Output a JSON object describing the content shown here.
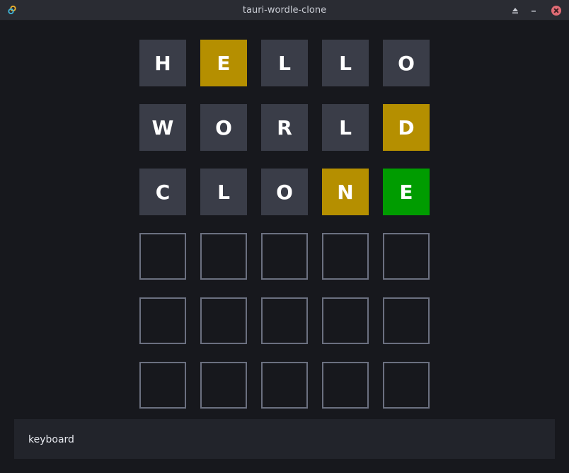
{
  "window": {
    "title": "tauri-wordle-clone"
  },
  "icons": {
    "app": "tauri-app-icon",
    "keep_above": "eject-icon",
    "minimize": "minimize-icon",
    "close": "close-icon"
  },
  "colors": {
    "absent": "#3a3d48",
    "present": "#b58f00",
    "correct": "#009c00",
    "empty_border": "#6b7080",
    "close": "#e06c75"
  },
  "board": {
    "rows": [
      [
        {
          "letter": "H",
          "state": "absent"
        },
        {
          "letter": "E",
          "state": "present"
        },
        {
          "letter": "L",
          "state": "absent"
        },
        {
          "letter": "L",
          "state": "absent"
        },
        {
          "letter": "O",
          "state": "absent"
        }
      ],
      [
        {
          "letter": "W",
          "state": "absent"
        },
        {
          "letter": "O",
          "state": "absent"
        },
        {
          "letter": "R",
          "state": "absent"
        },
        {
          "letter": "L",
          "state": "absent"
        },
        {
          "letter": "D",
          "state": "present"
        }
      ],
      [
        {
          "letter": "C",
          "state": "absent"
        },
        {
          "letter": "L",
          "state": "absent"
        },
        {
          "letter": "O",
          "state": "absent"
        },
        {
          "letter": "N",
          "state": "present"
        },
        {
          "letter": "E",
          "state": "correct"
        }
      ],
      [
        {
          "letter": "",
          "state": "empty"
        },
        {
          "letter": "",
          "state": "empty"
        },
        {
          "letter": "",
          "state": "empty"
        },
        {
          "letter": "",
          "state": "empty"
        },
        {
          "letter": "",
          "state": "empty"
        }
      ],
      [
        {
          "letter": "",
          "state": "empty"
        },
        {
          "letter": "",
          "state": "empty"
        },
        {
          "letter": "",
          "state": "empty"
        },
        {
          "letter": "",
          "state": "empty"
        },
        {
          "letter": "",
          "state": "empty"
        }
      ],
      [
        {
          "letter": "",
          "state": "empty"
        },
        {
          "letter": "",
          "state": "empty"
        },
        {
          "letter": "",
          "state": "empty"
        },
        {
          "letter": "",
          "state": "empty"
        },
        {
          "letter": "",
          "state": "empty"
        }
      ]
    ]
  },
  "keyboard": {
    "label": "keyboard"
  }
}
